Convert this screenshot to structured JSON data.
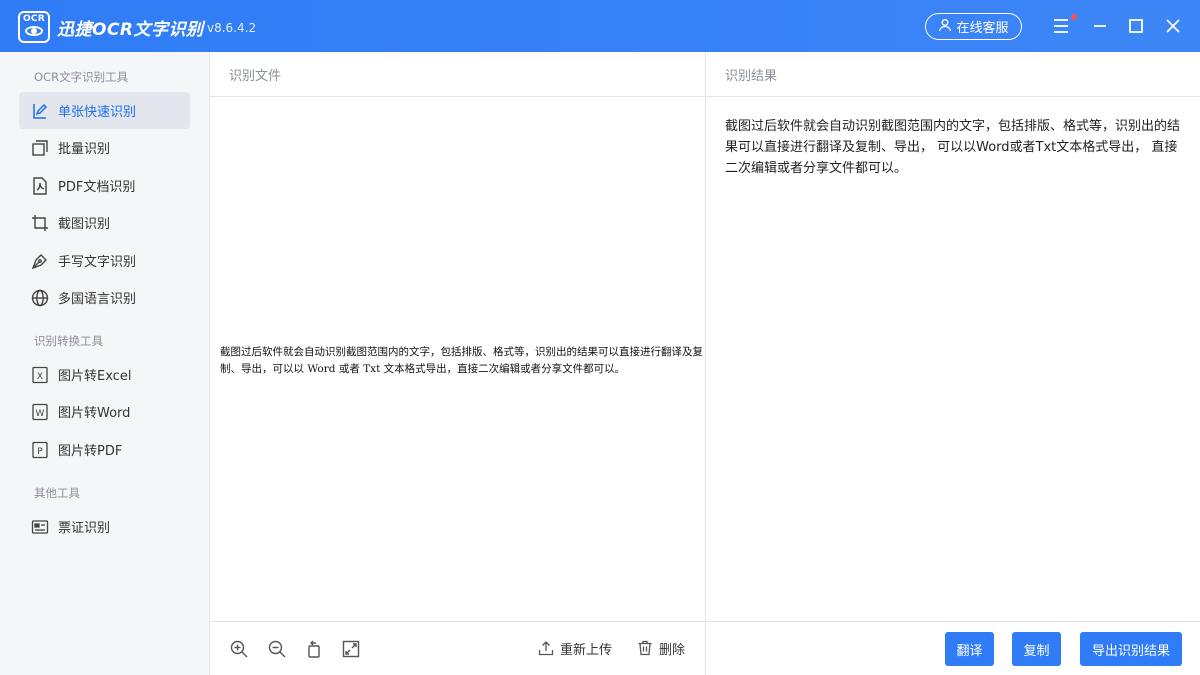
{
  "app": {
    "logo_text": "OCR",
    "title": "迅捷OCR文字识别",
    "version": "v8.6.4.2",
    "service_label": "在线客服"
  },
  "sidebar": {
    "sections": [
      {
        "label": "OCR文字识别工具"
      },
      {
        "label": "识别转换工具"
      },
      {
        "label": "其他工具"
      }
    ],
    "items": [
      {
        "label": "单张快速识别",
        "icon": "single-scan-icon",
        "active": true
      },
      {
        "label": "批量识别",
        "icon": "batch-icon"
      },
      {
        "label": "PDF文档识别",
        "icon": "pdf-doc-icon"
      },
      {
        "label": "截图识别",
        "icon": "crop-icon"
      },
      {
        "label": "手写文字识别",
        "icon": "pen-icon"
      },
      {
        "label": "多国语言识别",
        "icon": "globe-icon"
      },
      {
        "label": "图片转Excel",
        "icon": "excel-icon"
      },
      {
        "label": "图片转Word",
        "icon": "word-icon"
      },
      {
        "label": "图片转PDF",
        "icon": "pdf-icon"
      },
      {
        "label": "票证识别",
        "icon": "ticket-icon"
      }
    ]
  },
  "left_panel": {
    "header": "识别文件",
    "preview_text": "截图过后软件就会自动识别截图范围内的文字，包括排版、格式等，识别出的结果可以直接进行翻译及复制、导出，可以以 Word 或者 Txt 文本格式导出，直接二次编辑或者分享文件都可以。",
    "reupload_label": "重新上传",
    "delete_label": "删除"
  },
  "right_panel": {
    "header": "识别结果",
    "result_text": "截图过后软件就会自动识别截图范围内的文字，包括排版、格式等，识别出的结果可以直接进行翻译及复制、导出， 可以以Word或者Txt文本格式导出， 直接二次编辑或者分享文件都可以。",
    "translate_label": "翻译",
    "copy_label": "复制",
    "export_label": "导出识别结果"
  },
  "colors": {
    "brand": "#2f7cf6",
    "active_text": "#1e6ff0",
    "notification": "#ff4d4f"
  }
}
